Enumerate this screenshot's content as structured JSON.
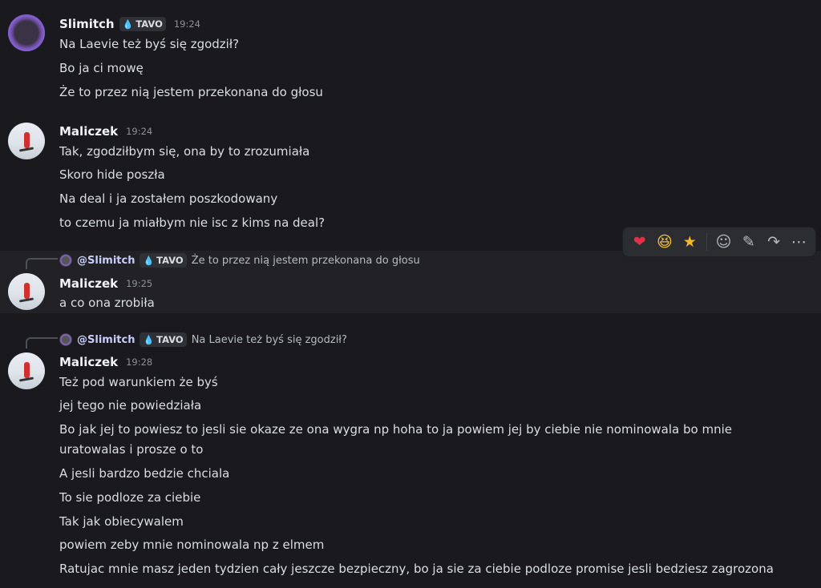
{
  "colors": {
    "background": "#1a1a1e",
    "text": "#dbdee1",
    "username": "#f2f3f5",
    "timestamp": "#8e9297",
    "mention": "#c9cdfb",
    "heart": "#e0314b"
  },
  "messages": [
    {
      "author": "Slimitch",
      "tag": "TAVO",
      "time": "19:24",
      "lines": [
        "Na Laevie też byś się zgodził?",
        "Bo ja ci mowę",
        "Że to przez nią jestem przekonana do głosu"
      ]
    },
    {
      "author": "Maliczek",
      "time": "19:24",
      "lines": [
        "Tak, zgodziłbym się, ona by to zrozumiała",
        "Skoro hide poszła",
        "Na deal i ja zostałem poszkodowany",
        "to czemu ja miałbym nie isc z kims na deal?"
      ]
    },
    {
      "reply": {
        "user": "@Slimitch",
        "tag": "TAVO",
        "text": "Że to przez nią jestem przekonana do głosu"
      },
      "author": "Maliczek",
      "time": "19:25",
      "lines": [
        "a co ona zrobiła"
      ]
    },
    {
      "reply": {
        "user": "@Slimitch",
        "tag": "TAVO",
        "text": "Na Laevie też byś się zgodził?"
      },
      "author": "Maliczek",
      "time": "19:28",
      "lines": [
        "Też pod warunkiem że byś",
        "jej tego nie powiedziała",
        "Bo jak jej to powiesz to jesli sie okaze ze ona wygra np hoha to ja powiem jej by ciebie nie nominowala bo mnie",
        "uratowalas i prosze o to",
        "A jesli bardzo bedzie chciala",
        "To sie podloze za ciebie",
        "Tak jak obiecywalem",
        "powiem zeby mnie nominowala np z elmem",
        "Ratujac mnie masz jeden tydzien cały jeszcze bezpieczny, bo ja sie za ciebie podloze promise jesli bedziesz zagrozona"
      ]
    }
  ],
  "toolbar": {
    "reactions": [
      "heart-emoji",
      "laughing-emoji",
      "star-emoji"
    ],
    "actions": [
      "add-reaction-icon",
      "edit-icon",
      "forward-icon",
      "more-icon"
    ]
  }
}
